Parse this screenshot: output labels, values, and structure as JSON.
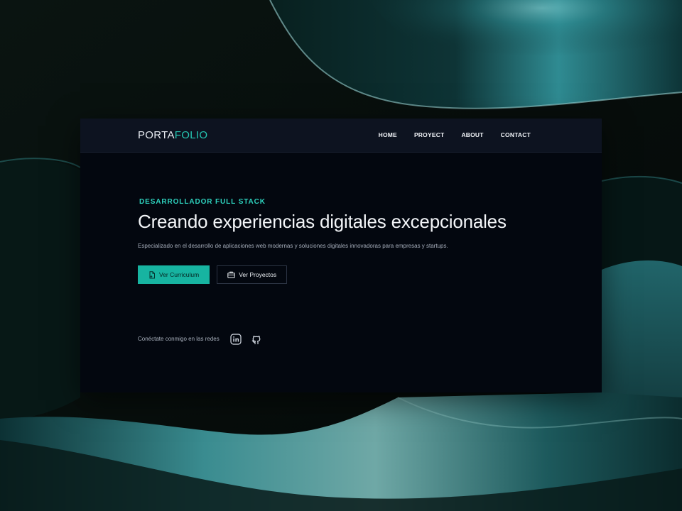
{
  "logo": {
    "part_a": "PORTA",
    "part_b": "FOLIO"
  },
  "nav": {
    "items": [
      {
        "label": "HOME"
      },
      {
        "label": "PROYECT"
      },
      {
        "label": "ABOUT"
      },
      {
        "label": "CONTACT"
      }
    ]
  },
  "hero": {
    "eyebrow": "DESARROLLADOR FULL STACK",
    "headline": "Creando experiencias digitales excepcionales",
    "subtitle": "Especializado en el desarrollo de aplicaciones web modernas y soluciones digitales innovadoras para empresas y startups."
  },
  "actions": {
    "primary_label": "Ver Curriculum",
    "primary_icon": "document-icon",
    "secondary_label": "Ver Proyectos",
    "secondary_icon": "briefcase-icon"
  },
  "social": {
    "text": "Conéctate conmigo en las redes",
    "icons": [
      "linkedin-icon",
      "github-icon"
    ]
  },
  "colors": {
    "accent": "#25c7b3",
    "button_primary": "#17b4a1",
    "navbar_bg": "#0d1320",
    "page_bg": "#03070f"
  }
}
